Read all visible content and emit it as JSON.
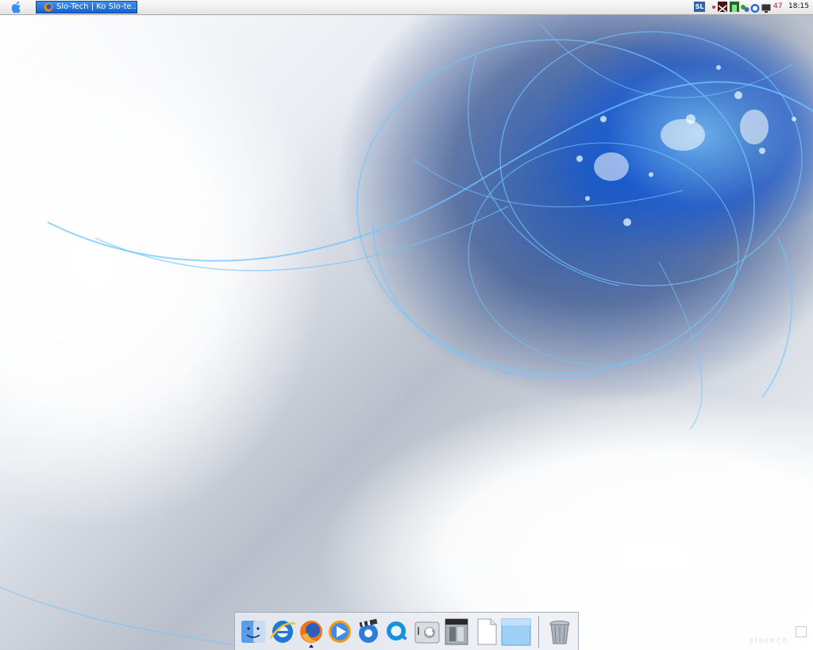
{
  "taskbar": {
    "active_task": "Slo-Tech | Ko Slo-te...",
    "tray": {
      "language": "SL",
      "count": "47",
      "clock": "18:15"
    }
  },
  "dock": {
    "items": [
      {
        "name": "finder-icon"
      },
      {
        "name": "internet-explorer-icon"
      },
      {
        "name": "firefox-icon"
      },
      {
        "name": "media-player-icon"
      },
      {
        "name": "media-center-icon"
      },
      {
        "name": "quicktime-icon"
      },
      {
        "name": "system-preferences-icon"
      },
      {
        "name": "games-folder-icon"
      },
      {
        "name": "document-icon"
      },
      {
        "name": "folder-icon"
      },
      {
        "name": "trash-icon"
      }
    ]
  },
  "watermark": "slotech",
  "colors": {
    "task_button": "#1f6fd8",
    "wallpaper_accent": "#0a5ad8",
    "tray_count": "#d01010"
  }
}
